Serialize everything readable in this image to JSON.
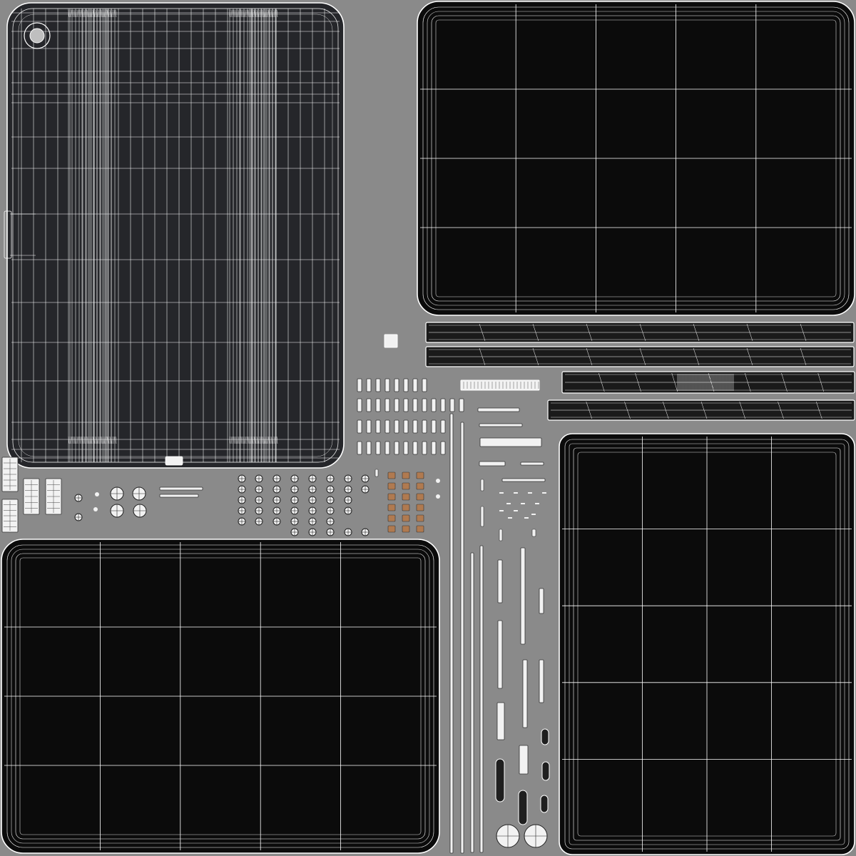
{
  "colors": {
    "background": "#8a8a8a",
    "screen_fill": "#0b0b0b",
    "back_shell_fill": "#25262a",
    "wire": "#ffffff",
    "wire_dim": "#d6d6d6",
    "part_fill": "#2a2a2a",
    "copper": "#b07a50",
    "part_light": "#f2f2f2"
  },
  "islands": [
    {
      "name": "uv-island-back-shell",
      "kind": "back-shell"
    },
    {
      "name": "uv-island-screen-top-right",
      "kind": "screen",
      "grid": [
        5,
        4
      ]
    },
    {
      "name": "uv-island-screen-bottom-left",
      "kind": "screen",
      "grid": [
        5,
        4
      ]
    },
    {
      "name": "uv-island-screen-bottom-right",
      "kind": "screen",
      "grid": [
        4,
        5
      ]
    },
    {
      "name": "uv-island-edge-strips",
      "kind": "strips"
    },
    {
      "name": "uv-island-small-parts",
      "kind": "small-parts"
    }
  ]
}
